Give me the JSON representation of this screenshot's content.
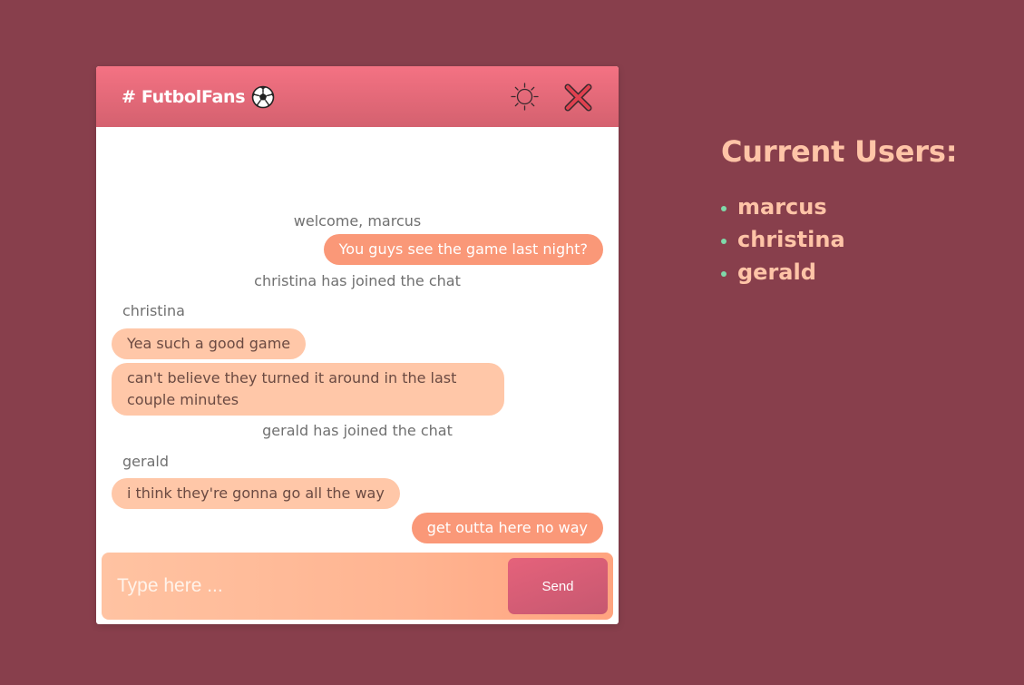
{
  "chat": {
    "title": "# FutbolFans",
    "title_icon": "soccer-ball-icon",
    "theme_toggle_icon": "sun-icon",
    "close_icon": "close-icon",
    "messages": [
      {
        "type": "system",
        "text": "welcome, marcus"
      },
      {
        "type": "outgoing",
        "text": "You guys see the game last night?"
      },
      {
        "type": "system",
        "text": "christina has joined the chat"
      },
      {
        "type": "author",
        "text": "christina"
      },
      {
        "type": "incoming",
        "text": "Yea such a good game"
      },
      {
        "type": "incoming",
        "text": "can't believe they turned it around in the last couple minutes"
      },
      {
        "type": "system",
        "text": "gerald has joined the chat"
      },
      {
        "type": "author",
        "text": "gerald"
      },
      {
        "type": "incoming",
        "text": "i think they're gonna go all the way"
      },
      {
        "type": "outgoing",
        "text": "get outta here no way"
      }
    ],
    "input_placeholder": "Type here ...",
    "input_value": "",
    "send_label": "Send"
  },
  "users": {
    "title": "Current Users:",
    "list": [
      "marcus",
      "christina",
      "gerald"
    ],
    "online_dot_color": "#7fd9a9"
  },
  "colors": {
    "background": "#883f4c",
    "header_gradient_top": "#f47283",
    "outgoing_bubble": "#fa9878",
    "incoming_bubble": "#ffc7a8",
    "accent_text": "#ffc4a7"
  }
}
